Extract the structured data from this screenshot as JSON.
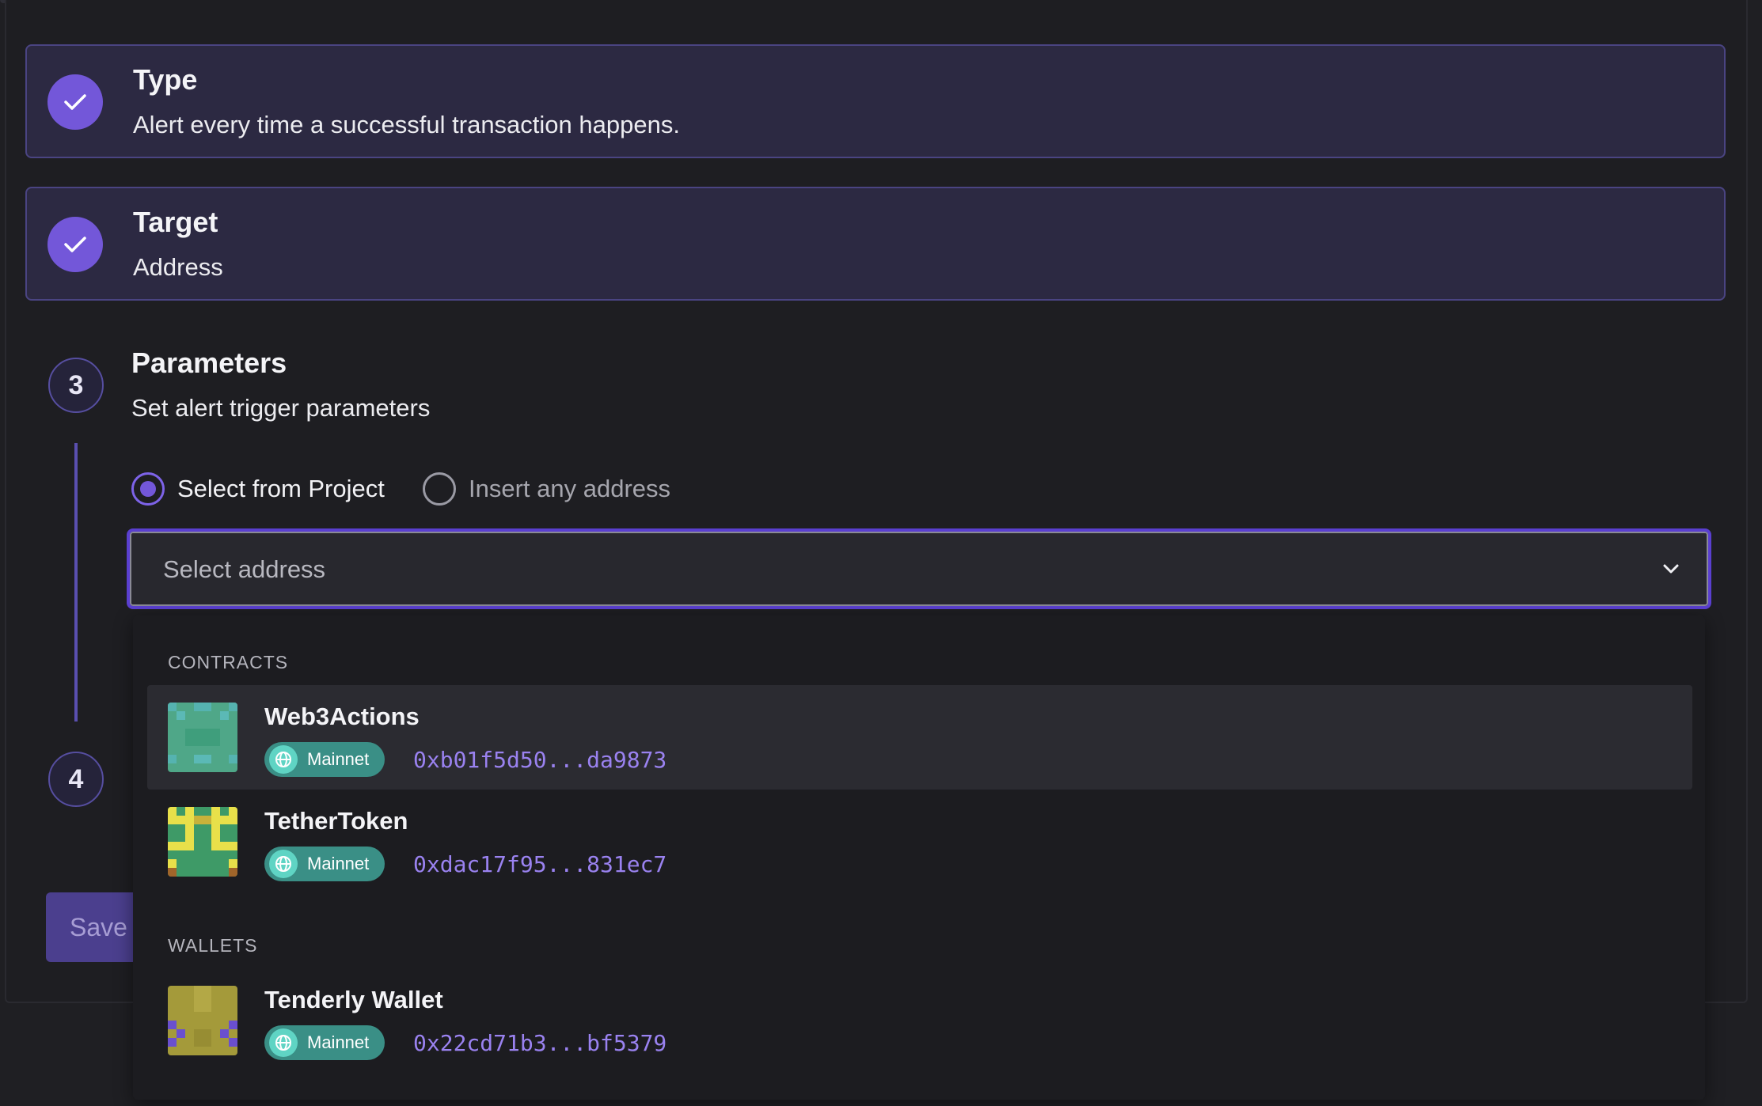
{
  "steps": {
    "type": {
      "title": "Type",
      "description": "Alert every time a successful transaction happens."
    },
    "target": {
      "title": "Target",
      "description": "Address"
    },
    "parameters": {
      "number": "3",
      "title": "Parameters",
      "description": "Set alert trigger parameters"
    },
    "next": {
      "number": "4"
    }
  },
  "source_options": {
    "select_from_project": "Select from Project",
    "insert_any_address": "Insert any address",
    "selected": "select_from_project"
  },
  "address_select": {
    "placeholder": "Select address"
  },
  "dropdown": {
    "contracts_label": "CONTRACTS",
    "wallets_label": "WALLETS",
    "contracts": [
      {
        "name": "Web3Actions",
        "network": "Mainnet",
        "address": "0xb01f5d50...da9873"
      },
      {
        "name": "TetherToken",
        "network": "Mainnet",
        "address": "0xdac17f95...831ec7"
      }
    ],
    "wallets": [
      {
        "name": "Tenderly Wallet",
        "network": "Mainnet",
        "address": "0x22cd71b3...bf5379"
      }
    ]
  },
  "actions": {
    "save_label": "Save"
  },
  "colors": {
    "accent": "#7357d9",
    "completed_card_bg": "#2c2942",
    "network_badge": "#3a8f86",
    "address_text": "#9a82f0"
  }
}
